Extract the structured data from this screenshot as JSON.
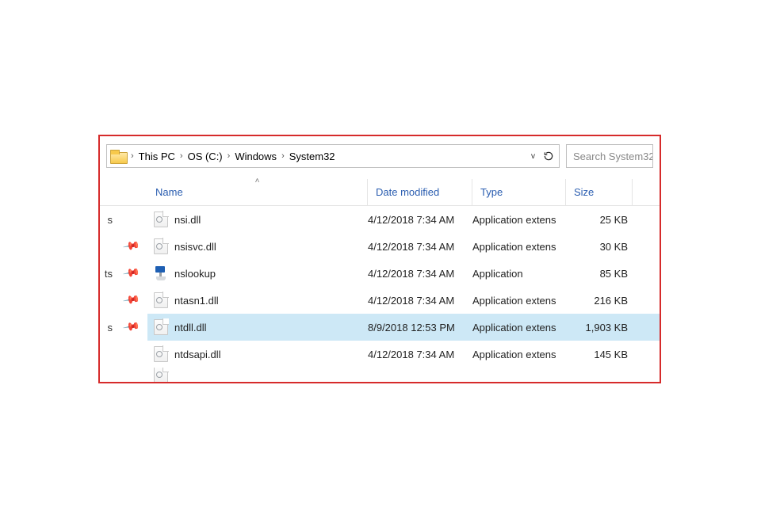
{
  "breadcrumb": {
    "seg1": "This PC",
    "seg2": "OS (C:)",
    "seg3": "Windows",
    "seg4": "System32"
  },
  "search": {
    "placeholder": "Search System32"
  },
  "columns": {
    "name": "Name",
    "date": "Date modified",
    "type": "Type",
    "size": "Size"
  },
  "nav_fragments": {
    "f1": "s",
    "f2": "ts",
    "f3": "s"
  },
  "files": {
    "0": {
      "name": "nsi.dll",
      "date": "4/12/2018 7:34 AM",
      "type": "Application extens",
      "size": "25 KB",
      "icon": "dll",
      "selected": false
    },
    "1": {
      "name": "nsisvc.dll",
      "date": "4/12/2018 7:34 AM",
      "type": "Application extens",
      "size": "30 KB",
      "icon": "dll",
      "selected": false
    },
    "2": {
      "name": "nslookup",
      "date": "4/12/2018 7:34 AM",
      "type": "Application",
      "size": "85 KB",
      "icon": "exe",
      "selected": false
    },
    "3": {
      "name": "ntasn1.dll",
      "date": "4/12/2018 7:34 AM",
      "type": "Application extens",
      "size": "216 KB",
      "icon": "dll",
      "selected": false
    },
    "4": {
      "name": "ntdll.dll",
      "date": "8/9/2018 12:53 PM",
      "type": "Application extens",
      "size": "1,903 KB",
      "icon": "dll",
      "selected": true
    },
    "5": {
      "name": "ntdsapi.dll",
      "date": "4/12/2018 7:34 AM",
      "type": "Application extens",
      "size": "145 KB",
      "icon": "dll",
      "selected": false
    }
  }
}
